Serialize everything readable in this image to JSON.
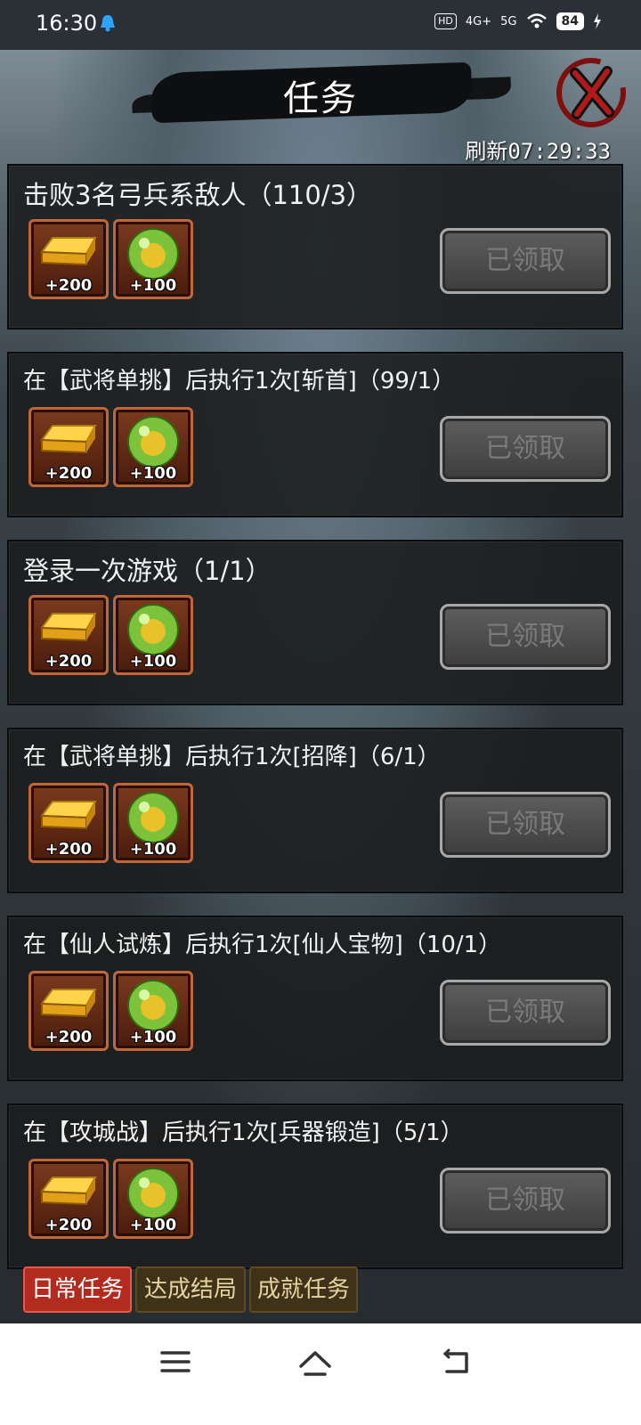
{
  "status_bar": {
    "time": "16:30",
    "signal_labels": [
      "HD",
      "4G+",
      "5G"
    ],
    "battery": "84"
  },
  "header": {
    "title": "任务",
    "refresh_label": "刷新07:29:33"
  },
  "tasks": [
    {
      "title": "击败3名弓兵系敌人（110/3）",
      "rewards": [
        {
          "icon": "gold-bar-icon",
          "amount": "+200"
        },
        {
          "icon": "green-orb-icon",
          "amount": "+100"
        }
      ],
      "button": "已领取"
    },
    {
      "title": "在【武将单挑】后执行1次[斩首]（99/1）",
      "rewards": [
        {
          "icon": "gold-bar-icon",
          "amount": "+200"
        },
        {
          "icon": "green-orb-icon",
          "amount": "+100"
        }
      ],
      "button": "已领取"
    },
    {
      "title": "登录一次游戏（1/1）",
      "rewards": [
        {
          "icon": "gold-bar-icon",
          "amount": "+200"
        },
        {
          "icon": "green-orb-icon",
          "amount": "+100"
        }
      ],
      "button": "已领取"
    },
    {
      "title": "在【武将单挑】后执行1次[招降]（6/1）",
      "rewards": [
        {
          "icon": "gold-bar-icon",
          "amount": "+200"
        },
        {
          "icon": "green-orb-icon",
          "amount": "+100"
        }
      ],
      "button": "已领取"
    },
    {
      "title": "在【仙人试炼】后执行1次[仙人宝物]（10/1）",
      "rewards": [
        {
          "icon": "gold-bar-icon",
          "amount": "+200"
        },
        {
          "icon": "green-orb-icon",
          "amount": "+100"
        }
      ],
      "button": "已领取"
    },
    {
      "title": "在【攻城战】后执行1次[兵器锻造]（5/1）",
      "rewards": [
        {
          "icon": "gold-bar-icon",
          "amount": "+200"
        },
        {
          "icon": "green-orb-icon",
          "amount": "+100"
        }
      ],
      "button": "已领取"
    }
  ],
  "tabs": [
    {
      "label": "日常任务",
      "active": true
    },
    {
      "label": "达成结局",
      "active": false
    },
    {
      "label": "成就任务",
      "active": false
    }
  ],
  "colors": {
    "active_tab": "#b32a1e",
    "inactive_tab": "#3e3218",
    "claimed_button": "#4d4d4d"
  }
}
